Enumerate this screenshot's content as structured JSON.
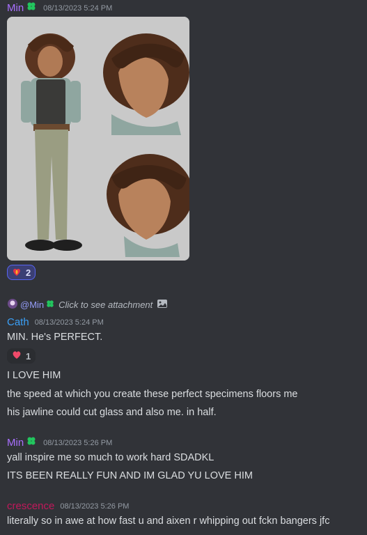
{
  "colors": {
    "min_name": "#a970ff",
    "cath_name": "#3ba0f7",
    "crescence_name": "#c2185b",
    "clover": "#22c55e",
    "mention": "#949cf7"
  },
  "messages": [
    {
      "author": "Min",
      "timestamp": "08/13/2023 5:24 PM",
      "attachment_icon": "character-sheet-image",
      "reaction": {
        "emoji": "fire-heart-emoji",
        "count": "2"
      }
    },
    {
      "author": "Cath",
      "timestamp": "08/13/2023 5:24 PM",
      "reply": {
        "mention": "@Min",
        "text": "Click to see attachment"
      },
      "lines": [
        "MIN. He's PERFECT."
      ],
      "reaction": {
        "emoji": "heart-emoji",
        "count": "1"
      },
      "followups": [
        "I LOVE HIM",
        "the speed at which you create these perfect specimens floors me",
        "his jawline could cut glass and also me. in half."
      ]
    },
    {
      "author": "Min",
      "timestamp": "08/13/2023 5:26 PM",
      "lines": [
        "yall inspire me so much to work hard SDADKL",
        "ITS BEEN REALLY FUN AND IM GLAD YU LOVE HIM"
      ]
    },
    {
      "author": "crescence",
      "timestamp": "08/13/2023 5:26 PM",
      "lines": [
        "literally so in awe at how fast u and aixen r whipping out fckn bangers jfc"
      ]
    }
  ]
}
